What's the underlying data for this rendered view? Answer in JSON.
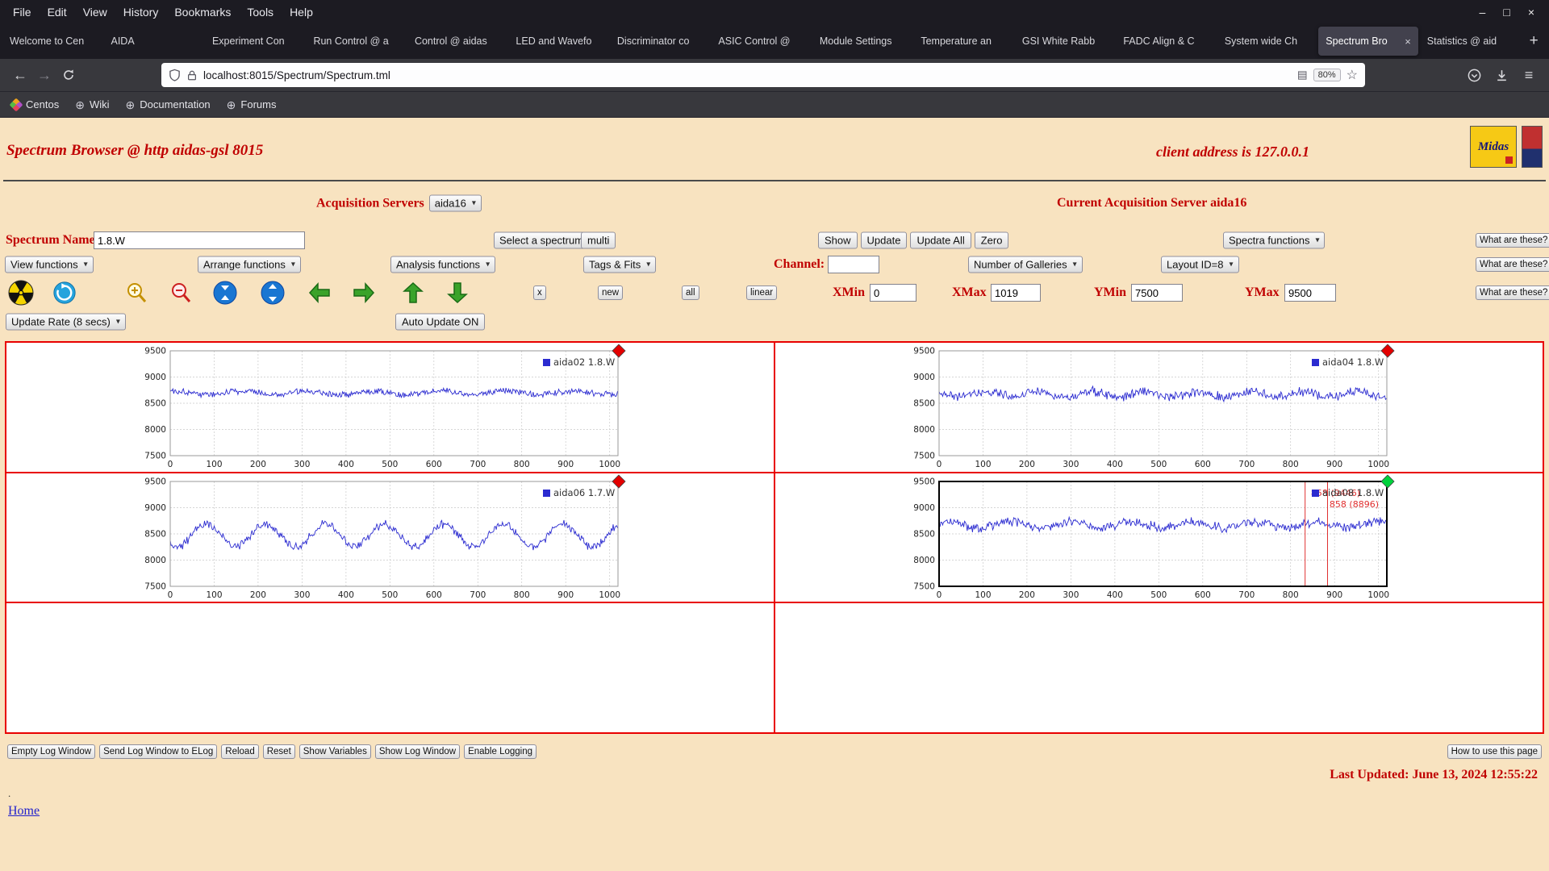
{
  "browser": {
    "menu": [
      "File",
      "Edit",
      "View",
      "History",
      "Bookmarks",
      "Tools",
      "Help"
    ],
    "window_controls": [
      "–",
      "□",
      "×"
    ],
    "tabs": [
      "Welcome to Cen",
      "AIDA",
      "Experiment Con",
      "Run Control @ a",
      "Control @ aidas",
      "LED and Wavefo",
      "Discriminator co",
      "ASIC Control @",
      "Module Settings",
      "Temperature an",
      "GSI White Rabb",
      "FADC Align & C",
      "System wide Ch",
      "Spectrum Bro",
      "Statistics @ aid"
    ],
    "active_tab_index": 13,
    "active_tab_close": "×",
    "new_tab_label": "+",
    "nav": {
      "back_icon": "←",
      "forward_icon": "→",
      "url": "localhost:8015/Spectrum/Spectrum.tml",
      "zoom_chip": "80%",
      "star_icon": "☆",
      "reader_icon": "▤",
      "menu_icon": "≡"
    },
    "bookmarks": [
      {
        "icon": "centos-logo-icon",
        "label": "Centos"
      },
      {
        "icon": "globe-icon",
        "label": "Wiki"
      },
      {
        "icon": "globe-icon",
        "label": "Documentation"
      },
      {
        "icon": "globe-icon",
        "label": "Forums"
      }
    ]
  },
  "page": {
    "title": "Spectrum Browser @ http aidas-gsl 8015",
    "client": "client address is 127.0.0.1",
    "logo_text": "Midas",
    "acq": {
      "label": "Acquisition Servers",
      "server": "aida16",
      "current": "Current Acquisition Server aida16"
    },
    "name_row": {
      "label": "Spectrum Name:",
      "value": "1.8.W",
      "select_spectrum": "Select a spectrum",
      "multi": "multi",
      "show": "Show",
      "update": "Update",
      "update_all": "Update All",
      "zero": "Zero",
      "spectra_functions": "Spectra functions",
      "what": "What are these?"
    },
    "fn_row": {
      "view": "View functions",
      "arrange": "Arrange functions",
      "analysis": "Analysis functions",
      "tags": "Tags & Fits",
      "channel_label": "Channel:",
      "channel_value": "",
      "galleries": "Number of Galleries",
      "layout": "Layout ID=8",
      "what": "What are these?"
    },
    "range_row": {
      "x": "x",
      "new": "new",
      "all": "all",
      "linear": "linear",
      "xmin_label": "XMin",
      "xmin": "0",
      "xmax_label": "XMax",
      "xmax": "1019",
      "ymin_label": "YMin",
      "ymin": "7500",
      "ymax_label": "YMax",
      "ymax": "9500",
      "what": "What are these?"
    },
    "icons": [
      "radiation-icon",
      "refresh-icon",
      "zoom-in-icon",
      "zoom-out-icon",
      "compress-y-icon",
      "expand-y-icon",
      "shift-left-icon",
      "shift-right-icon",
      "shift-up-icon",
      "shift-down-icon"
    ],
    "rate_row": {
      "rate": "Update Rate (8 secs)",
      "auto": "Auto Update ON"
    },
    "log_buttons": [
      "Empty Log Window",
      "Send Log Window to ELog",
      "Reload",
      "Reset",
      "Show Variables",
      "Show Log Window",
      "Enable Logging"
    ],
    "help_button": "How to use this page",
    "last_updated": "Last Updated: June 13, 2024 12:55:22",
    "dot": ".",
    "home": "Home"
  },
  "chart_data": [
    {
      "type": "line",
      "legend": "aida02 1.8.W",
      "line_color": "#2b2bd0",
      "xlim": [
        0,
        1019
      ],
      "ylim": [
        7500,
        9500
      ],
      "x_ticks": [
        0,
        100,
        200,
        300,
        400,
        500,
        600,
        700,
        800,
        900,
        1000
      ],
      "y_ticks": [
        7500,
        8000,
        8500,
        9000,
        9500
      ],
      "grid": true,
      "legend_position": "top-right",
      "corner_marker": {
        "shape": "diamond",
        "color": "#e30000"
      },
      "selected": false,
      "series_profile": {
        "description": "flat noisy spectrum",
        "baseline": 8700,
        "noise": 75,
        "wander": 35,
        "period": 150,
        "phase": 1.0,
        "seed": 101
      },
      "cursors": [],
      "annotations": []
    },
    {
      "type": "line",
      "legend": "aida04 1.8.W",
      "line_color": "#2b2bd0",
      "xlim": [
        0,
        1019
      ],
      "ylim": [
        7500,
        9500
      ],
      "x_ticks": [
        0,
        100,
        200,
        300,
        400,
        500,
        600,
        700,
        800,
        900,
        1000
      ],
      "y_ticks": [
        7500,
        8000,
        8500,
        9000,
        9500
      ],
      "grid": true,
      "legend_position": "top-right",
      "corner_marker": {
        "shape": "diamond",
        "color": "#e30000"
      },
      "selected": false,
      "series_profile": {
        "description": "flat noisy spectrum",
        "baseline": 8670,
        "noise": 105,
        "wander": 55,
        "period": 120,
        "phase": 2.2,
        "seed": 202
      },
      "cursors": [],
      "annotations": []
    },
    {
      "type": "line",
      "legend": "aida06 1.7.W",
      "line_color": "#2b2bd0",
      "xlim": [
        0,
        1019
      ],
      "ylim": [
        7500,
        9500
      ],
      "x_ticks": [
        0,
        100,
        200,
        300,
        400,
        500,
        600,
        700,
        800,
        900,
        1000
      ],
      "y_ticks": [
        7500,
        8000,
        8500,
        9000,
        9500
      ],
      "grid": true,
      "legend_position": "top-right",
      "corner_marker": {
        "shape": "diamond",
        "color": "#e30000"
      },
      "selected": false,
      "series_profile": {
        "description": "slow oscillating noisy spectrum",
        "baseline": 8470,
        "noise": 95,
        "wander": 215,
        "period": 135,
        "phase": 4.0,
        "seed": 303
      },
      "cursors": [],
      "annotations": []
    },
    {
      "type": "line",
      "legend": "aida08 1.8.W",
      "line_color": "#2b2bd0",
      "xlim": [
        0,
        1019
      ],
      "ylim": [
        7500,
        9500
      ],
      "x_ticks": [
        0,
        100,
        200,
        300,
        400,
        500,
        600,
        700,
        800,
        900,
        1000
      ],
      "y_ticks": [
        7500,
        8000,
        8500,
        9000,
        9500
      ],
      "grid": true,
      "legend_position": "top-right",
      "corner_marker": {
        "shape": "diamond",
        "color": "#00d23c"
      },
      "selected": true,
      "series_profile": {
        "description": "flat noisy spectrum",
        "baseline": 8670,
        "noise": 105,
        "wander": 55,
        "period": 140,
        "phase": 0.7,
        "seed": 404
      },
      "cursors": [
        833,
        884
      ],
      "annotations": [
        "858 (9446)",
        "858 (8896)"
      ]
    }
  ]
}
